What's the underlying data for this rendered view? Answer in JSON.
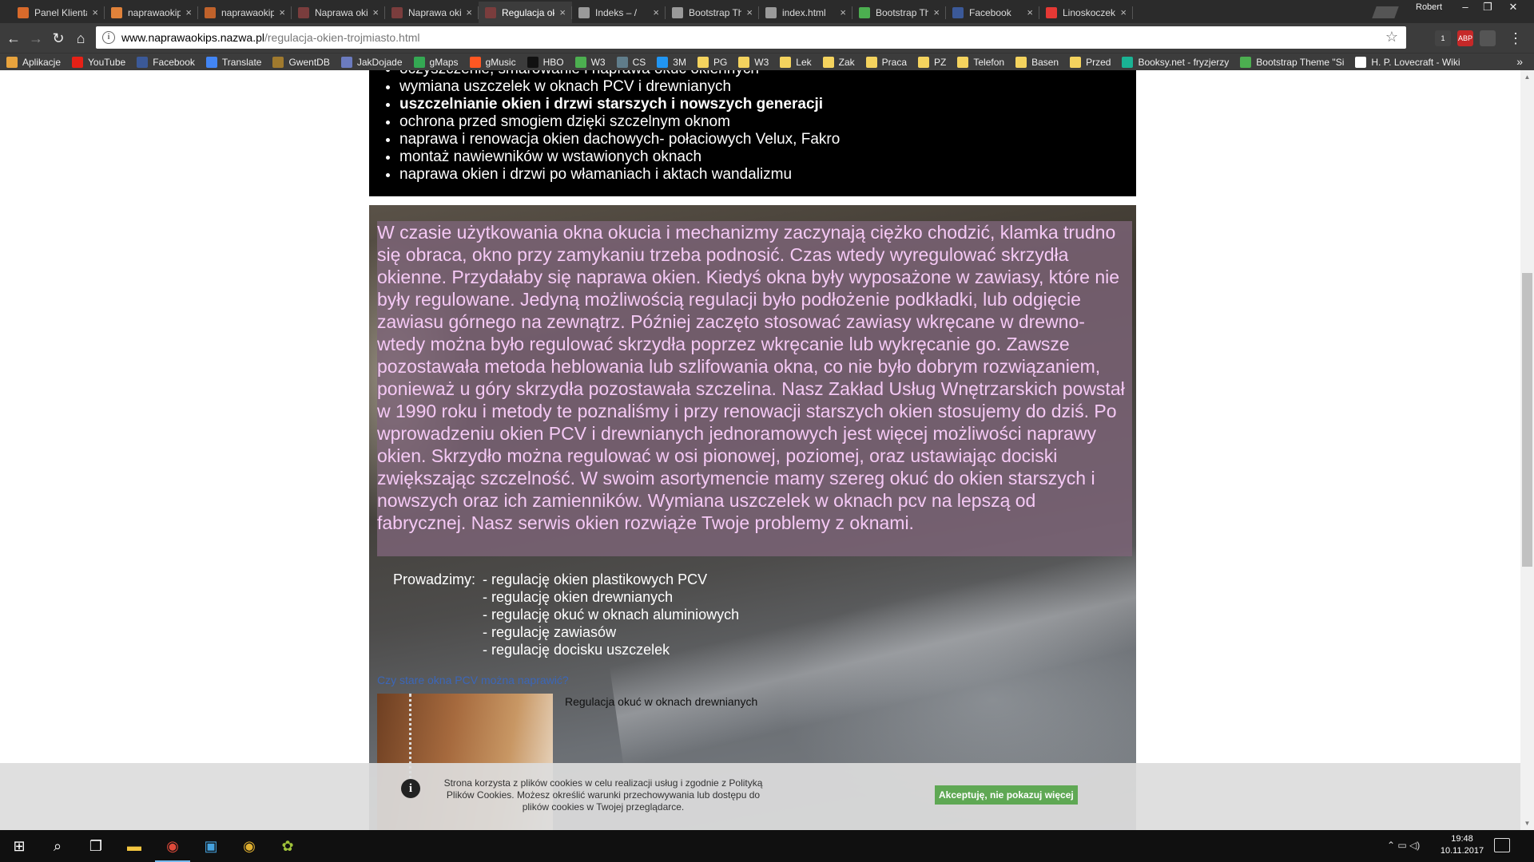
{
  "browser": {
    "tabs": [
      {
        "label": "Panel Klienta -",
        "color": "#d86a2b",
        "active": false
      },
      {
        "label": "naprawaokips",
        "color": "#e0823a",
        "active": false
      },
      {
        "label": "naprawaokips",
        "color": "#c0622b",
        "active": false
      },
      {
        "label": "Naprawa okien",
        "color": "#7a3d3d",
        "active": false
      },
      {
        "label": "Naprawa okien",
        "color": "#7a3d3d",
        "active": false
      },
      {
        "label": "Regulacja okien",
        "color": "#7a3d3d",
        "active": true
      },
      {
        "label": "Indeks – /",
        "color": "#9a9a9a",
        "active": false
      },
      {
        "label": "Bootstrap Them",
        "color": "#9a9a9a",
        "active": false
      },
      {
        "label": "index.html",
        "color": "#9a9a9a",
        "active": false
      },
      {
        "label": "Bootstrap Them",
        "color": "#4caf50",
        "active": false
      },
      {
        "label": "Facebook",
        "color": "#3b5998",
        "active": false
      },
      {
        "label": "Linoskoczek",
        "color": "#e53935",
        "active": false
      }
    ],
    "profile_name": "Robert",
    "url_host": "www.naprawaokips.nazwa.pl",
    "url_path": "/regulacja-okien-trojmiasto.html",
    "extensions": [
      {
        "label": "1",
        "color": "#444"
      },
      {
        "label": "ABP",
        "color": "#c62828"
      },
      {
        "label": "",
        "color": "#555"
      }
    ],
    "bookmarks": [
      {
        "label": "Aplikacje",
        "color": "#e8a33d"
      },
      {
        "label": "YouTube",
        "color": "#e62117"
      },
      {
        "label": "Facebook",
        "color": "#3b5998"
      },
      {
        "label": "Translate",
        "color": "#4285f4"
      },
      {
        "label": "GwentDB",
        "color": "#a07a2e"
      },
      {
        "label": "JakDojade",
        "color": "#6b7bbf"
      },
      {
        "label": "gMaps",
        "color": "#34a853"
      },
      {
        "label": "gMusic",
        "color": "#ff5722"
      },
      {
        "label": "HBO",
        "color": "#111111"
      },
      {
        "label": "W3",
        "color": "#4caf50"
      },
      {
        "label": "CS",
        "color": "#607d8b"
      },
      {
        "label": "3M",
        "color": "#2196f3"
      },
      {
        "label": "PG",
        "color": "#f4d35e"
      },
      {
        "label": "W3",
        "color": "#f4d35e"
      },
      {
        "label": "Lek",
        "color": "#f4d35e"
      },
      {
        "label": "Zak",
        "color": "#f4d35e"
      },
      {
        "label": "Praca",
        "color": "#f4d35e"
      },
      {
        "label": "PZ",
        "color": "#f4d35e"
      },
      {
        "label": "Telefon",
        "color": "#f4d35e"
      },
      {
        "label": "Basen",
        "color": "#f4d35e"
      },
      {
        "label": "Przed",
        "color": "#f4d35e"
      },
      {
        "label": "Booksy.net - fryzjerzy",
        "color": "#1ab394"
      },
      {
        "label": "Bootstrap Theme \"Si",
        "color": "#4caf50"
      },
      {
        "label": "H. P. Lovecraft - Wiki",
        "color": "#ffffff"
      }
    ],
    "bookmarks_more": "»"
  },
  "page": {
    "services": [
      {
        "text": "oczyszczenie, smarowanie i naprawa okuć okiennych",
        "bold": false
      },
      {
        "text": "wymiana uszczelek w oknach PCV i drewnianych",
        "bold": false
      },
      {
        "text": "uszczelnianie okien i drzwi starszych i nowszych generacji",
        "bold": true
      },
      {
        "text": "ochrona przed smogiem dzięki szczelnym oknom",
        "bold": false
      },
      {
        "text": "naprawa i renowacja okien dachowych- połaciowych Velux, Fakro",
        "bold": false
      },
      {
        "text": "montaż nawiewników w wstawionych oknach",
        "bold": false
      },
      {
        "text": "naprawa okien i drzwi po włamaniach i aktach wandalizmu",
        "bold": false
      }
    ],
    "intro": "W czasie użytkowania okna okucia i mechanizmy zaczynają ciężko chodzić, klamka trudno się obraca, okno przy zamykaniu trzeba podnosić. Czas wtedy wyregulować skrzydła okienne. Przydałaby się naprawa okien. Kiedyś okna były wyposażone w zawiasy, które nie były regulowane. Jedyną możliwością regulacji było podłożenie podkładki, lub odgięcie zawiasu górnego na zewnątrz. Później zaczęto stosować zawiasy wkręcane w drewno- wtedy można było regulować skrzydła poprzez wkręcanie lub wykręcanie go. Zawsze pozostawała metoda heblowania lub szlifowania okna, co nie było dobrym rozwiązaniem, ponieważ u góry skrzydła pozostawała szczelina. Nasz Zakład Usług Wnętrzarskich powstał w 1990 roku i metody te poznaliśmy i przy renowacji starszych okien stosujemy do dziś. Po wprowadzeniu okien PCV i drewnianych jednoramowych jest więcej możliwości naprawy okien. Skrzydło można regulować w osi pionowej, poziomej, oraz ustawiając dociski zwiększając szczelność. W swoim asortymencie mamy szereg okuć do okien starszych i nowszych oraz ich zamienników.  Wymiana uszczelek w oknach pcv na lepszą od fabrycznej. Nasz serwis okien rozwiąże Twoje problemy z oknami.",
    "offer_label": "Prowadzimy:",
    "offer_items": [
      "- regulację okien plastikowych PCV",
      "- regulację okien drewnianych",
      "- regulację okuć w oknach aluminiowych",
      "- regulację zawiasów",
      "- regulację docisku uszczelek"
    ],
    "faq_link": "Czy stare okna PCV można naprawić?",
    "thumb_caption": "Regulacja okuć w oknach drewnianych"
  },
  "cookie": {
    "text": "Strona korzysta z plików cookies w celu realizacji usług i zgodnie z Polityką Plików Cookies. Możesz określić warunki przechowywania lub dostępu do plików cookies w Twojej przeglądarce.",
    "accept_label": "Akceptuję, nie pokazuj więcej"
  },
  "taskbar": {
    "time": "19:48",
    "date": "10.11.2017"
  }
}
